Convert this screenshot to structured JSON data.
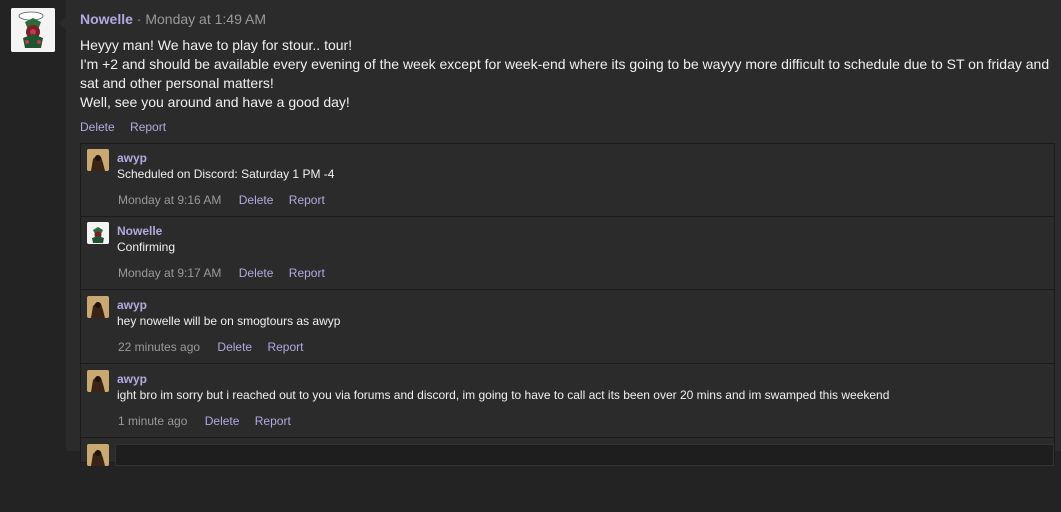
{
  "post": {
    "author": "Nowelle",
    "separator": "·",
    "time": "Monday at 1:49 AM",
    "body": [
      "Heyyy man! We have to play for stour.. tour!",
      "I'm +2 and should be available every evening of the week except for week-end where its going to be wayyy more difficult to schedule due to ST on friday and sat and other personal matters!",
      "Well, see you around and have a good day!"
    ],
    "actions": {
      "delete": "Delete",
      "report": "Report"
    }
  },
  "comments": [
    {
      "author": "awyp",
      "text": "Scheduled on Discord: Saturday 1 PM -4",
      "time": "Monday at 9:16 AM",
      "delete": "Delete",
      "report": "Report"
    },
    {
      "author": "Nowelle",
      "text": "Confirming",
      "time": "Monday at 9:17 AM",
      "delete": "Delete",
      "report": "Report"
    },
    {
      "author": "awyp",
      "text": "hey nowelle will be on smogtours as awyp",
      "time": "22 minutes ago",
      "delete": "Delete",
      "report": "Report"
    },
    {
      "author": "awyp",
      "text": "ight bro im sorry but i reached out to you via forums and discord, im going to have to call act its been over 20 mins and im swamped this weekend",
      "time": "1 minute ago",
      "delete": "Delete",
      "report": "Report"
    }
  ],
  "colors": {
    "page_bg": "#232323",
    "panel_bg": "#2b2b2b",
    "author_link": "#b3a9e0",
    "muted_text": "#9a9a9a"
  }
}
